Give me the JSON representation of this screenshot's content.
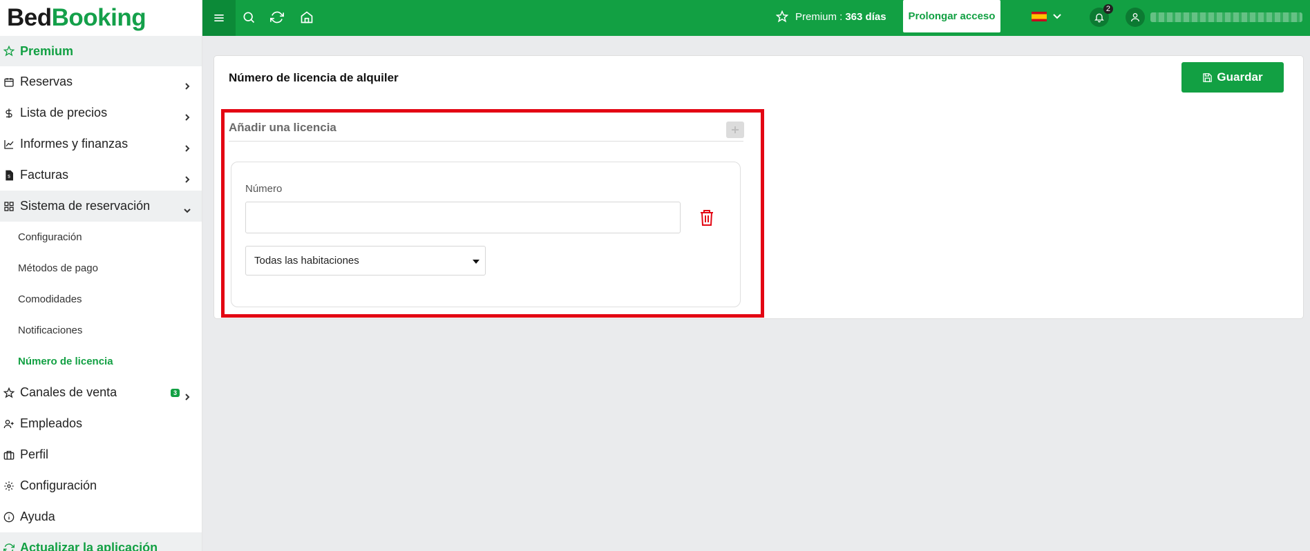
{
  "brand": {
    "part1": "Bed",
    "part2": "Booking"
  },
  "sidebar": {
    "premium": "Premium",
    "items": [
      {
        "label": "Reservas",
        "icon": "calendar-icon"
      },
      {
        "label": "Lista de precios",
        "icon": "dollar-icon"
      },
      {
        "label": "Informes y finanzas",
        "icon": "chart-icon"
      },
      {
        "label": "Facturas",
        "icon": "invoice-icon"
      },
      {
        "label": "Sistema de reservación",
        "icon": "grid-icon"
      }
    ],
    "subitems": [
      "Configuración",
      "Métodos de pago",
      "Comodidades",
      "Notificaciones",
      "Número de licencia"
    ],
    "items2": [
      {
        "label": "Canales de venta",
        "icon": "star-icon",
        "badge": "3"
      },
      {
        "label": "Empleados",
        "icon": "user-plus-icon"
      },
      {
        "label": "Perfil",
        "icon": "briefcase-icon"
      },
      {
        "label": "Configuración",
        "icon": "gear-icon"
      },
      {
        "label": "Ayuda",
        "icon": "info-icon"
      }
    ],
    "update": "Actualizar la aplicación"
  },
  "topbar": {
    "premium_label": "Premium :",
    "premium_days": "363 días",
    "extend_button": "Prolongar acceso",
    "language": "es",
    "notifications_count": "2"
  },
  "main": {
    "title": "Número de licencia de alquiler",
    "save_button": "Guardar",
    "section_title": "Añadir una licencia",
    "field_label": "Número",
    "number_value": "",
    "room_select": "Todas las habitaciones"
  },
  "colors": {
    "brand_green": "#12a043",
    "highlight_red": "#e30613",
    "delete_red": "#e30613"
  }
}
